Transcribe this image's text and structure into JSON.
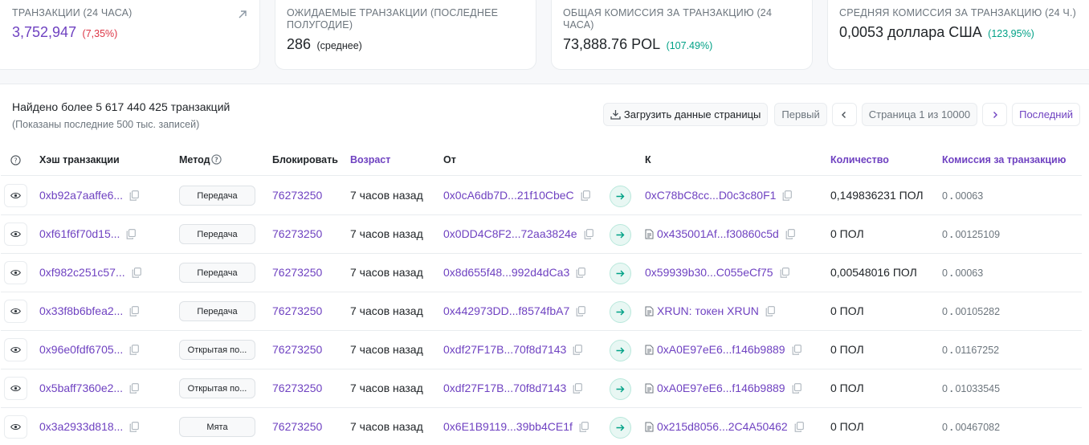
{
  "stats": [
    {
      "label": "ТРАНЗАКЦИИ (24 ЧАСА)",
      "value": "3,752,947",
      "sub": "(7,35%)"
    },
    {
      "label": "ОЖИДАЕМЫЕ ТРАНЗАКЦИИ (ПОСЛЕДНЕЕ ПОЛУГОДИЕ)",
      "value": "286",
      "sub": "(среднее)"
    },
    {
      "label": "ОБЩАЯ КОМИССИЯ ЗА ТРАНЗАКЦИЮ (24 ЧАСА)",
      "value": "73,888.76 POL",
      "sub": "(107.49%)"
    },
    {
      "label": "СРЕДНЯЯ КОМИССИЯ ЗА ТРАНЗАКЦИЮ (24 Ч.)",
      "value": "0,0053 доллара США",
      "sub": "(123,95%)"
    }
  ],
  "summary": {
    "found": "Найдено более 5 617 440 425 транзакций",
    "shown": "(Показаны последние 500 тыс. записей)"
  },
  "pager": {
    "download": "Загрузить данные страницы",
    "first": "Первый",
    "page": "Страница 1 из 10000",
    "last": "Последний"
  },
  "columns": {
    "hash": "Хэш транзакции",
    "method": "Метод",
    "block": "Блокировать",
    "age": "Возраст",
    "from": "От",
    "to": "К",
    "amount": "Количество",
    "fee": "Комиссия за транзакцию"
  },
  "rows": [
    {
      "hash": "0xb92a7aaffe6...",
      "method": "Передача",
      "block": "76273250",
      "age": "7 часов назад",
      "from": "0x0cA6db7D...21f10CbeC",
      "to": "0xC78bC8cc...D0c3c80F1",
      "to_contract": false,
      "amount": "0,149836231 ПОЛ",
      "fee_int": "0",
      "fee_frac": "00063"
    },
    {
      "hash": "0xf61f6f70d15...",
      "method": "Передача",
      "block": "76273250",
      "age": "7 часов назад",
      "from": "0x0DD4C8F2...72aa3824e",
      "to": "0x435001Af...f30860c5d",
      "to_contract": true,
      "amount": "0 ПОЛ",
      "fee_int": "0",
      "fee_frac": "00125109"
    },
    {
      "hash": "0xf982c251c57...",
      "method": "Передача",
      "block": "76273250",
      "age": "7 часов назад",
      "from": "0x8d655f48...992d4dCa3",
      "to": "0x59939b30...C055eCf75",
      "to_contract": false,
      "amount": "0,00548016 ПОЛ",
      "fee_int": "0",
      "fee_frac": "00063"
    },
    {
      "hash": "0x33f8b6bfea2...",
      "method": "Передача",
      "block": "76273250",
      "age": "7 часов назад",
      "from": "0x442973DD...f8574fbA7",
      "to": "XRUN: токен XRUN",
      "to_contract": true,
      "amount": "0 ПОЛ",
      "fee_int": "0",
      "fee_frac": "00105282"
    },
    {
      "hash": "0x96e0fdf6705...",
      "method": "Открытая по...",
      "block": "76273250",
      "age": "7 часов назад",
      "from": "0xdf27F17B...70f8d7143",
      "to": "0xA0E97eE6...f146b9889",
      "to_contract": true,
      "amount": "0 ПОЛ",
      "fee_int": "0",
      "fee_frac": "01167252"
    },
    {
      "hash": "0x5baff7360e2...",
      "method": "Открытая по...",
      "block": "76273250",
      "age": "7 часов назад",
      "from": "0xdf27F17B...70f8d7143",
      "to": "0xA0E97eE6...f146b9889",
      "to_contract": true,
      "amount": "0 ПОЛ",
      "fee_int": "0",
      "fee_frac": "01033545"
    },
    {
      "hash": "0x3a2933d818...",
      "method": "Мята",
      "block": "76273250",
      "age": "7 часов назад",
      "from": "0x6E1B9119...39bb4CE1f",
      "to": "0x215d8056...2C4A50462",
      "to_contract": true,
      "amount": "0 ПОЛ",
      "fee_int": "0",
      "fee_frac": "00467082"
    }
  ],
  "colors": {
    "accent": "#6f42c1",
    "negative": "#dc3545",
    "positive": "#00a186"
  }
}
